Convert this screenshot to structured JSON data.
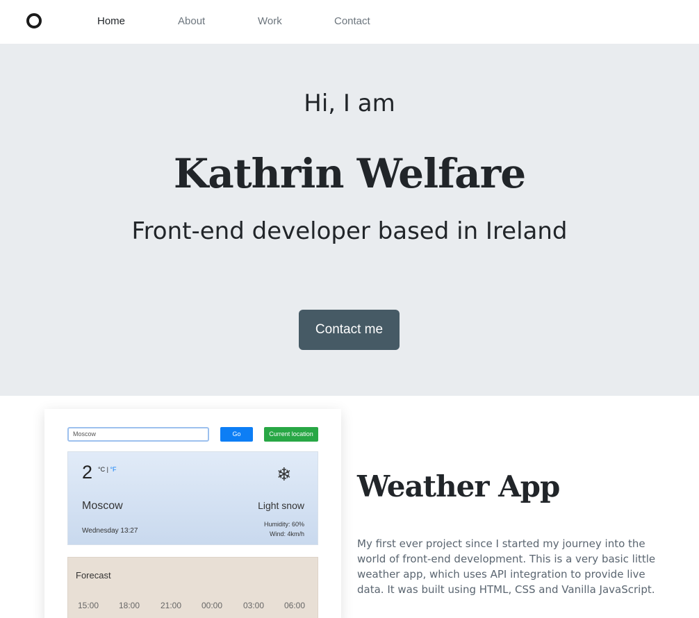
{
  "nav": {
    "items": [
      {
        "label": "Home",
        "active": true
      },
      {
        "label": "About",
        "active": false
      },
      {
        "label": "Work",
        "active": false
      },
      {
        "label": "Contact",
        "active": false
      }
    ]
  },
  "hero": {
    "greeting": "Hi, I am",
    "name": "Kathrin Welfare",
    "tagline": "Front-end developer based in Ireland",
    "button_label": "Contact me",
    "background": "#e9ecef",
    "button_color": "#465a65"
  },
  "project": {
    "title": "Weather App",
    "description": "My first ever project since I started my journey into the world of front-end development. This is a very basic little weather app, which uses API integration to provide live data. It was built using HTML, CSS and Vanilla JavaScript.",
    "screenshot": {
      "search_value": "Moscow",
      "go_label": "Go",
      "location_label": "Current location",
      "temperature": "2",
      "unit_c": "°C",
      "unit_sep": " | ",
      "unit_f": "°F",
      "icon": "snowflake-icon",
      "city": "Moscow",
      "condition": "Light snow",
      "datetime": "Wednesday 13:27",
      "humidity": "Humidity: 60%",
      "wind": "Wind: 4km/h",
      "forecast_title": "Forecast",
      "forecast_times": [
        "15:00",
        "18:00",
        "21:00",
        "00:00",
        "03:00",
        "06:00"
      ]
    }
  }
}
